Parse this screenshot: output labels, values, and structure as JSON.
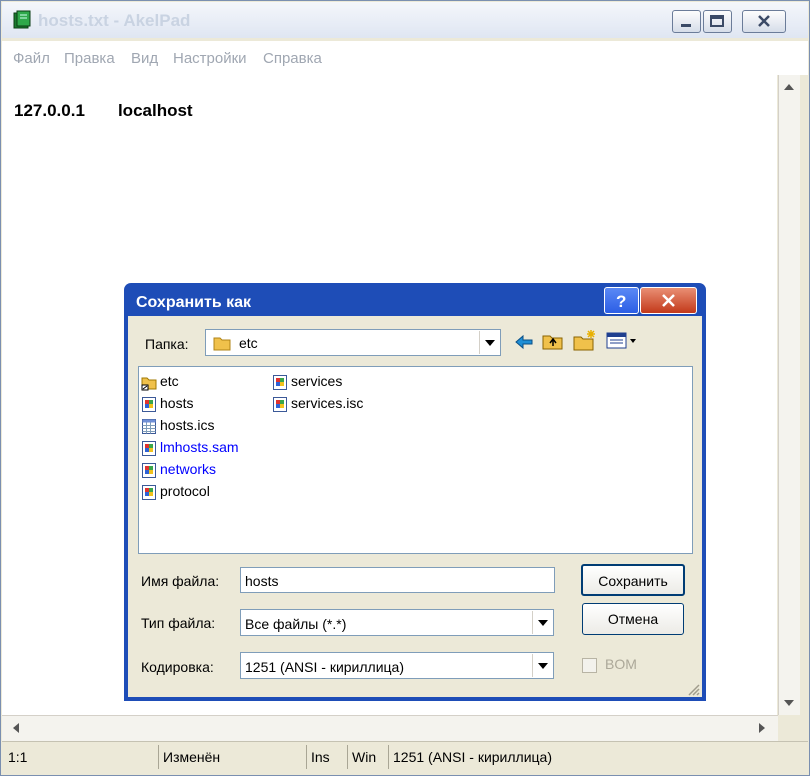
{
  "window": {
    "title": "hosts.txt - AkelPad"
  },
  "menu": [
    "Файл",
    "Правка",
    "Вид",
    "Настройки",
    "Справка"
  ],
  "editor": {
    "line1": "127.0.0.1       localhost"
  },
  "statusbar": {
    "position": "1:1",
    "modified": "Изменён",
    "insert_mode": "Ins",
    "newline": "Win",
    "encoding": "1251  (ANSI - кириллица)"
  },
  "dialog": {
    "title": "Сохранить как",
    "folder_label": "Папка:",
    "folder_value": "etc",
    "files": [
      {
        "name": "etc",
        "icon": "folder-shortcut-icon",
        "color": "#000000"
      },
      {
        "name": "hosts",
        "icon": "system-file-icon",
        "color": "#000000"
      },
      {
        "name": "hosts.ics",
        "icon": "table-file-icon",
        "color": "#000000"
      },
      {
        "name": "lmhosts.sam",
        "icon": "system-file-icon",
        "color": "#0000ff"
      },
      {
        "name": "networks",
        "icon": "system-file-icon",
        "color": "#0000ff"
      },
      {
        "name": "protocol",
        "icon": "system-file-icon",
        "color": "#000000"
      },
      {
        "name": "services",
        "icon": "system-file-icon",
        "color": "#000000"
      },
      {
        "name": "services.isc",
        "icon": "system-file-icon",
        "color": "#000000"
      }
    ],
    "filename_label": "Имя файла:",
    "filename_value": "hosts",
    "filetype_label": "Тип файла:",
    "filetype_value": "Все файлы (*.*)",
    "encoding_label": "Кодировка:",
    "encoding_value": "1251  (ANSI - кириллица)",
    "save_label": "Сохранить",
    "cancel_label": "Отмена",
    "bom_label": "BOM"
  },
  "colors": {
    "dialog_titlebar": "#1e4db7",
    "link_blue": "#0000ff"
  }
}
